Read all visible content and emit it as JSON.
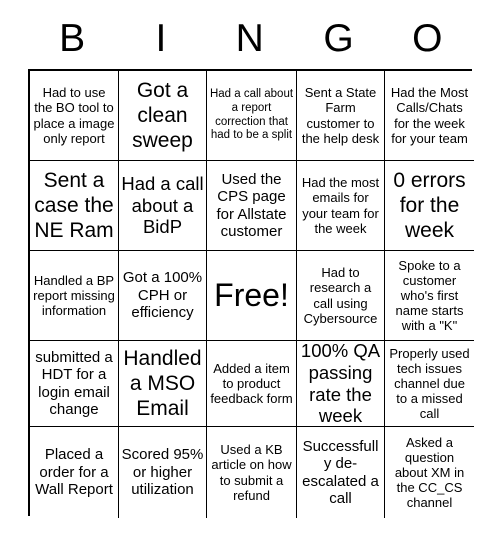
{
  "card": {
    "title": "BINGO",
    "header_letters": [
      "B",
      "I",
      "N",
      "G",
      "O"
    ],
    "columns": 5,
    "rows": 5,
    "free_space_label": "Free!",
    "free_space_index": 12,
    "colors": {
      "background": "#ffffff",
      "text": "#000000",
      "border": "#000000"
    },
    "cells": [
      {
        "text": "Had to use the BO tool to place a image only report",
        "size": "s"
      },
      {
        "text": "Got a clean sweep",
        "size": "xl"
      },
      {
        "text": "Had a call about a report correction that had to be a split",
        "size": "xs"
      },
      {
        "text": "Sent a State Farm customer to the help desk",
        "size": "s"
      },
      {
        "text": "Had the Most Calls/Chats for the week for your team",
        "size": "s"
      },
      {
        "text": "Sent a case the NE Ram",
        "size": "xl"
      },
      {
        "text": "Had a call about a BidP",
        "size": "l"
      },
      {
        "text": "Used the CPS page for Allstate customer",
        "size": "m"
      },
      {
        "text": "Had the most emails for your team for the week",
        "size": "s"
      },
      {
        "text": "0 errors for the week",
        "size": "xl"
      },
      {
        "text": "Handled a BP report missing information",
        "size": "s"
      },
      {
        "text": "Got a 100% CPH or efficiency",
        "size": "m"
      },
      {
        "text": "Free!",
        "size": "free"
      },
      {
        "text": "Had to research a call using Cybersource",
        "size": "s"
      },
      {
        "text": "Spoke to a customer who's first name starts with a \"K\"",
        "size": "s"
      },
      {
        "text": "submitted a HDT for a login email change",
        "size": "m"
      },
      {
        "text": "Handled a MSO Email",
        "size": "xl"
      },
      {
        "text": "Added a item to product feedback form",
        "size": "s"
      },
      {
        "text": "100% QA passing rate the week",
        "size": "l"
      },
      {
        "text": "Properly used tech issues channel due to a missed call",
        "size": "s"
      },
      {
        "text": "Placed a order for a Wall Report",
        "size": "m"
      },
      {
        "text": "Scored 95% or higher utilization",
        "size": "m"
      },
      {
        "text": "Used a KB article on how to submit a refund",
        "size": "s"
      },
      {
        "text": "Successfully de-escalated a call",
        "size": "m"
      },
      {
        "text": "Asked a question about XM in the CC_CS channel",
        "size": "s"
      }
    ]
  }
}
